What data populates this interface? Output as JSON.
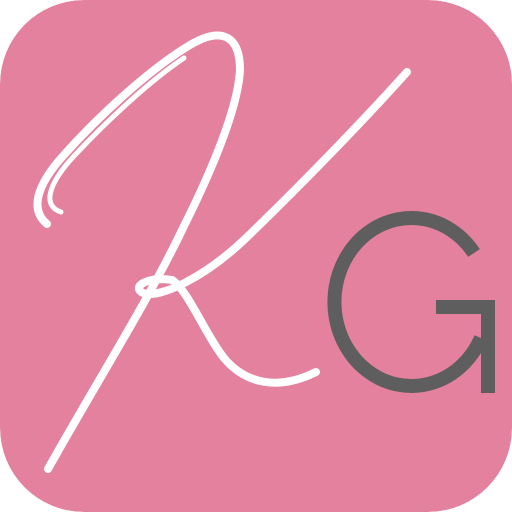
{
  "icon": {
    "monogram": {
      "script_letter": "K",
      "sans_letter": "G"
    },
    "colors": {
      "background": "#E3819E",
      "script_letter": "#FFFFFF",
      "sans_letter": "#5E5E5E"
    }
  }
}
